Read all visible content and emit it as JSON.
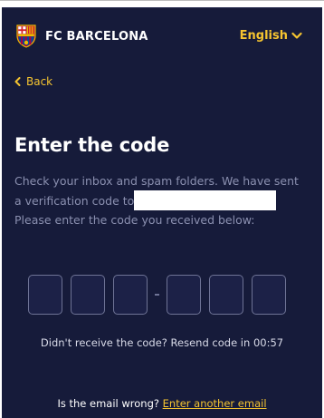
{
  "header": {
    "brand": "FC BARCELONA",
    "language": "English",
    "language_icon": "chevron-down-icon",
    "logo": "fc-barcelona-crest"
  },
  "back": {
    "label": "Back",
    "icon": "chevron-left-icon"
  },
  "main": {
    "title": "Enter the code",
    "description_line1": "Check your inbox and spam folders. We have sent",
    "description_line2": "a verification code to",
    "description_line3": "Please enter the code you received below:",
    "code_length": 6,
    "resend_text": "Didn't receive the code? Resend code in 00:57",
    "email_wrong_text": "Is the email wrong?",
    "enter_another_email": "Enter another email"
  },
  "colors": {
    "background": "#161b3a",
    "accent": "#f5c430",
    "muted_text": "#8b90b0",
    "box_border": "#6e7395"
  }
}
